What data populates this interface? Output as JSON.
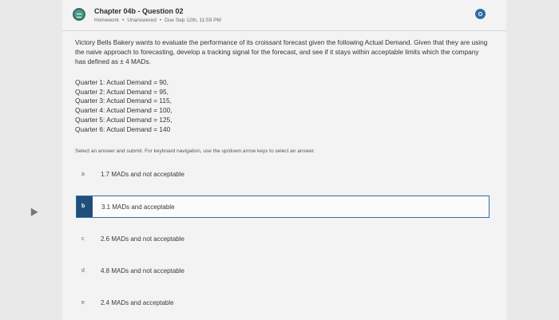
{
  "header": {
    "title": "Chapter 04b - Question 02",
    "meta_type": "Homework",
    "meta_status": "Unanswered",
    "meta_due": "Due Sep 12th, 11:59 PM",
    "separator": "•"
  },
  "question": {
    "prompt": "Victory Bells Bakery wants to evaluate the performance of its croissant forecast given the following Actual Demand. Given that they are using the naive approach to forecasting, develop a tracking signal for the forecast, and see if it stays within acceptable limits which the company has defined as ± 4 MADs.",
    "quarters": [
      "Quarter 1: Actual Demand = 90,",
      "Quarter 2: Actual Demand = 95,",
      "Quarter 3: Actual Demand = 115,",
      "Quarter 4: Actual Demand = 100,",
      "Quarter 5: Actual Demand = 125,",
      "Quarter 6: Actual Demand = 140"
    ],
    "instruction": "Select an answer and submit. For keyboard navigation, use the up/down arrow keys to select an answer."
  },
  "options": [
    {
      "letter": "a",
      "text": "1.7 MADs and not acceptable"
    },
    {
      "letter": "b",
      "text": "3.1 MADs and acceptable"
    },
    {
      "letter": "c",
      "text": "2.6 MADs and not acceptable"
    },
    {
      "letter": "d",
      "text": "4.8 MADs and not acceptable"
    },
    {
      "letter": "e",
      "text": "2.4 MADs and acceptable"
    }
  ],
  "selected_option": "b",
  "colors": {
    "accent": "#2f6ea6",
    "selected_letter_bg": "#1f4f7a",
    "icon": "#4c9b8a"
  },
  "icons": {
    "question": "question-type-icon",
    "status": "status-dot-icon",
    "pointer": "mouse-pointer-icon"
  }
}
